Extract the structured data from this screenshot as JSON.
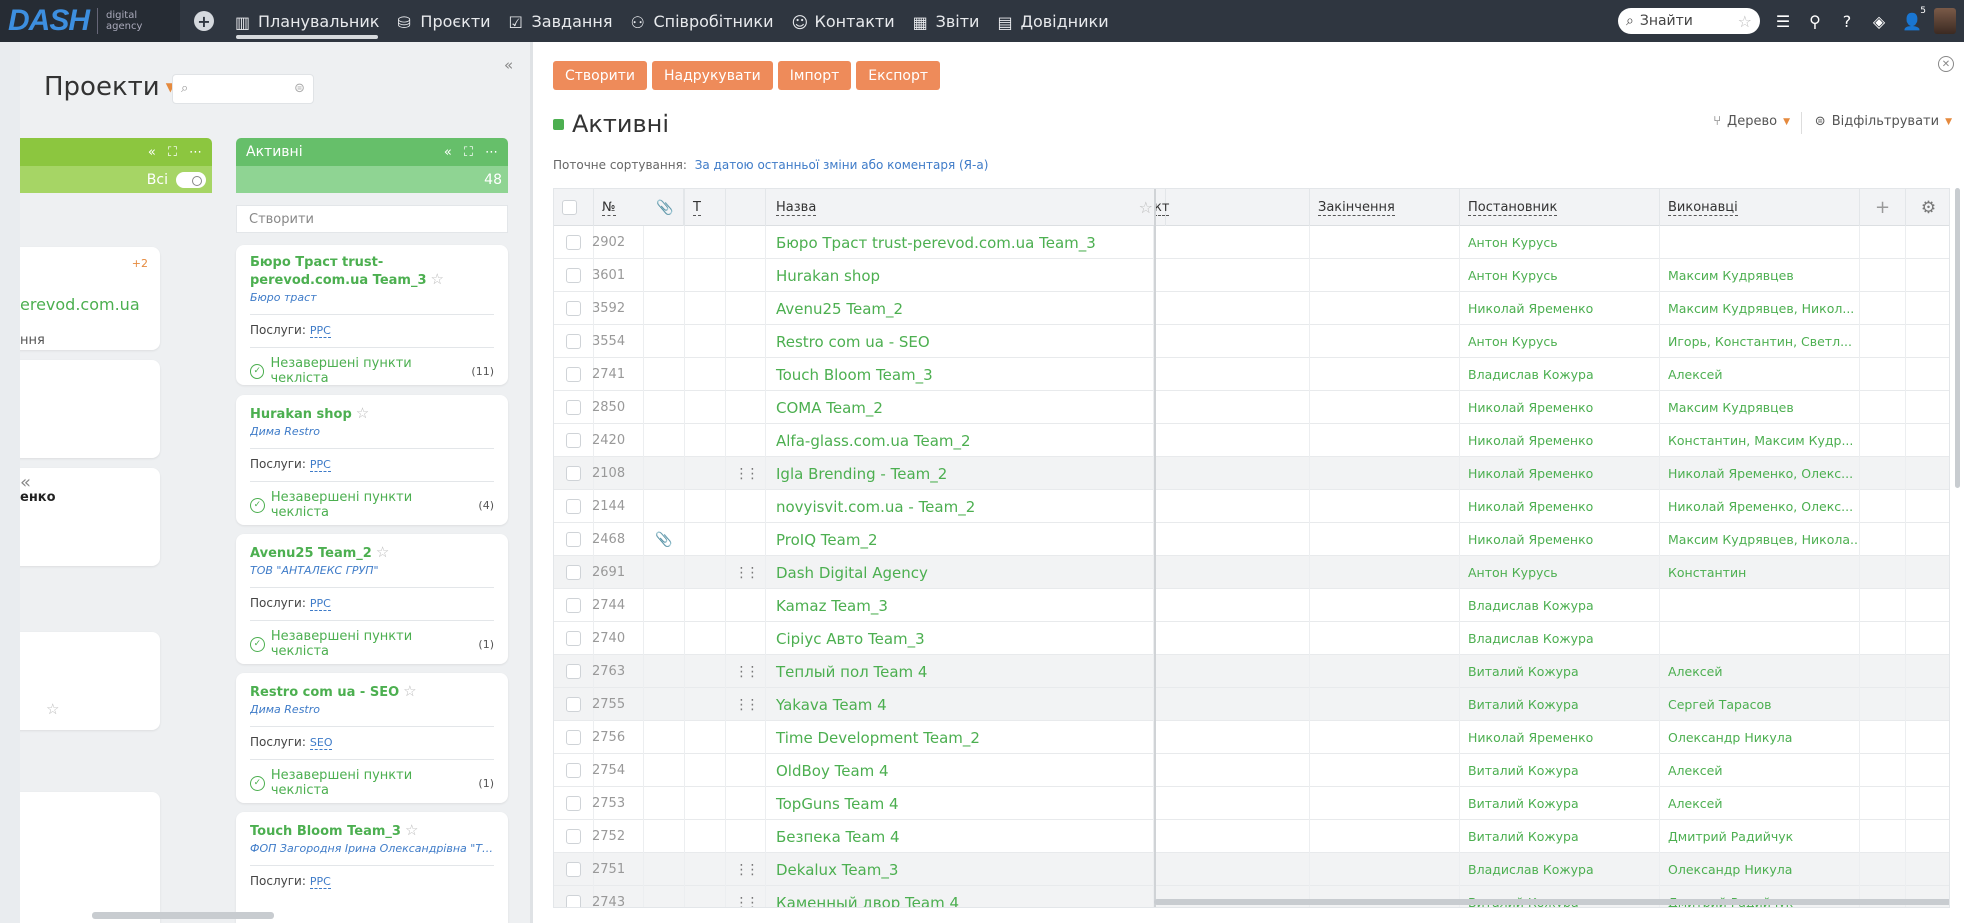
{
  "nav": {
    "logo": "DASH",
    "logo_sub1": "digital",
    "logo_sub2": "agency",
    "items": [
      {
        "label": "Планувальник",
        "icon": "planner-icon",
        "active": true
      },
      {
        "label": "Проєкти",
        "icon": "projects-icon"
      },
      {
        "label": "Завдання",
        "icon": "tasks-icon"
      },
      {
        "label": "Співробітники",
        "icon": "employees-icon"
      },
      {
        "label": "Контакти",
        "icon": "contacts-icon"
      },
      {
        "label": "Звіти",
        "icon": "reports-icon"
      },
      {
        "label": "Довідники",
        "icon": "directories-icon"
      }
    ],
    "search_placeholder": "Знайти",
    "user_badge": "5"
  },
  "left": {
    "title": "Проекти",
    "col_a": {
      "filter_label": "Всі",
      "count_badge": "+2",
      "fragment1": "erevod.com.ua",
      "fragment2": "ння",
      "fragment3": "енко"
    },
    "col_b": {
      "title": "Активні",
      "count": "48",
      "create_placeholder": "Створити",
      "cards": [
        {
          "title": "Бюро Траст trust-perevod.com.ua Team_3",
          "client": "Бюро траст",
          "service_label": "Послуги:",
          "service": "PPC",
          "checklist": "Незавершені пункти чекліста",
          "checklist_count": "(11)"
        },
        {
          "title": "Hurakan shop",
          "client": "Дима Restro",
          "service_label": "Послуги:",
          "service": "PPC",
          "checklist": "Незавершені пункти чекліста",
          "checklist_count": "(4)"
        },
        {
          "title": "Avenu25 Team_2",
          "client": "ТОВ \"АНТАЛЕКС ГРУП\"",
          "service_label": "Послуги:",
          "service": "PPC",
          "checklist": "Незавершені пункти чекліста",
          "checklist_count": "(1)"
        },
        {
          "title": "Restro com ua - SEO",
          "client": "Дима Restro",
          "service_label": "Послуги:",
          "service": "SEO",
          "checklist": "Незавершені пункти чекліста",
          "checklist_count": "(1)"
        },
        {
          "title": "Touch Bloom Team_3",
          "client": "ФОП Загородня Ірина Олександрівна \"То...",
          "service_label": "Послуги:",
          "service": "PPC"
        }
      ]
    }
  },
  "right": {
    "buttons": [
      "Створити",
      "Надрукувати",
      "Імпорт",
      "Експорт"
    ],
    "title": "Активні",
    "view_label": "Дерево",
    "filter_label": "Відфільтрувати",
    "sort_label": "Поточне сортування:",
    "sort_value": "За датою останньої зміни або коментаря (Я-а)",
    "columns": {
      "num": "№",
      "t": "Т",
      "name": "Назва",
      "start_frag": "кт",
      "end": "Закінчення",
      "author": "Постановник",
      "exec": "Виконавці"
    },
    "rows": [
      {
        "num": "2902",
        "name": "Бюро Траст trust-perevod.com.ua Team_3",
        "author": "Антон Курусь",
        "exec": ""
      },
      {
        "num": "3601",
        "name": "Hurakan shop",
        "author": "Антон Курусь",
        "exec": "Максим Кудрявцев"
      },
      {
        "num": "3592",
        "name": "Avenu25 Team_2",
        "author": "Николай Яременко",
        "exec": "Максим Кудрявцев, Никол..."
      },
      {
        "num": "3554",
        "name": "Restro com ua - SEO",
        "author": "Антон Курусь",
        "exec": "Игорь, Константин, Светл..."
      },
      {
        "num": "2741",
        "name": "Touch Bloom Team_3",
        "author": "Владислав Кожура",
        "exec": "Алексей"
      },
      {
        "num": "2850",
        "name": "COMA Team_2",
        "author": "Николай Яременко",
        "exec": "Максим Кудрявцев"
      },
      {
        "num": "2420",
        "name": "Alfa-glass.com.ua Team_2",
        "author": "Николай Яременко",
        "exec": "Константин, Максим Кудр..."
      },
      {
        "num": "2108",
        "name": "Igla Brending - Team_2",
        "author": "Николай Яременко",
        "exec": "Николай Яременко, Олекс...",
        "alt": true,
        "drag": true
      },
      {
        "num": "2144",
        "name": "novyisvit.com.ua - Team_2",
        "author": "Николай Яременко",
        "exec": "Николай Яременко, Олекс..."
      },
      {
        "num": "2468",
        "name": "ProIQ Team_2",
        "author": "Николай Яременко",
        "exec": "Максим Кудрявцев, Никола...",
        "clip": true
      },
      {
        "num": "2691",
        "name": "Dash Digital Agency",
        "author": "Антон Курусь",
        "exec": "Константин",
        "alt": true,
        "drag": true
      },
      {
        "num": "2744",
        "name": "Kamaz Team_3",
        "author": "Владислав Кожура",
        "exec": ""
      },
      {
        "num": "2740",
        "name": "Сіріус Авто Team_3",
        "author": "Владислав Кожура",
        "exec": ""
      },
      {
        "num": "2763",
        "name": "Теплый пол Team 4",
        "author": "Виталий Кожура",
        "exec": "Алексей",
        "alt": true,
        "drag": true
      },
      {
        "num": "2755",
        "name": "Yakava Team 4",
        "author": "Виталий Кожура",
        "exec": "Сергей Тарасов",
        "alt": true,
        "drag": true
      },
      {
        "num": "2756",
        "name": "Time Development Team_2",
        "author": "Николай Яременко",
        "exec": "Олександр Никула"
      },
      {
        "num": "2754",
        "name": "OldBoy Team 4",
        "author": "Виталий Кожура",
        "exec": "Алексей"
      },
      {
        "num": "2753",
        "name": "TopGuns Team 4",
        "author": "Виталий Кожура",
        "exec": "Алексей"
      },
      {
        "num": "2752",
        "name": "Безпека Team 4",
        "author": "Виталий Кожура",
        "exec": "Дмитрий Радийчук"
      },
      {
        "num": "2751",
        "name": "Dekalux Team_3",
        "author": "Владислав Кожура",
        "exec": "Олександр Никула",
        "alt": true,
        "drag": true
      },
      {
        "num": "2743",
        "name": "Каменный двор Team 4",
        "author": "Виталий Кожура",
        "exec": "Дмитрий Радийчук",
        "alt": true,
        "drag": true
      }
    ]
  },
  "colors": {
    "accent_green": "#4caf50",
    "button_orange": "#ee8b5a",
    "nav_bg": "#2f3640",
    "link_blue": "#3e7bc8"
  }
}
